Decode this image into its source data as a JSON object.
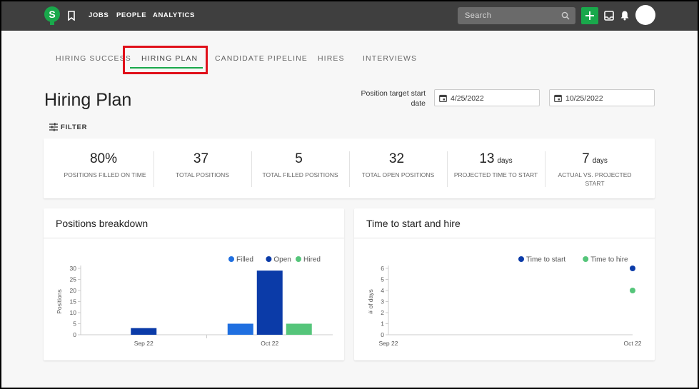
{
  "nav": {
    "logo_letter": "S",
    "links": [
      "JOBS",
      "PEOPLE",
      "ANALYTICS"
    ],
    "search_placeholder": "Search"
  },
  "tabs": [
    "HIRING SUCCESS",
    "HIRING PLAN",
    "CANDIDATE PIPELINE",
    "HIRES",
    "INTERVIEWS"
  ],
  "active_tab": "HIRING PLAN",
  "page": {
    "title": "Hiring Plan",
    "date_label": "Position target start date",
    "start_date": "4/25/2022",
    "end_date": "10/25/2022",
    "filter_label": "FILTER"
  },
  "stats": [
    {
      "value": "80%",
      "unit": "",
      "label": "POSITIONS FILLED ON TIME"
    },
    {
      "value": "37",
      "unit": "",
      "label": "TOTAL POSITIONS"
    },
    {
      "value": "5",
      "unit": "",
      "label": "TOTAL FILLED POSITIONS"
    },
    {
      "value": "32",
      "unit": "",
      "label": "TOTAL OPEN POSITIONS"
    },
    {
      "value": "13",
      "unit": "days",
      "label": "PROJECTED TIME TO START"
    },
    {
      "value": "7",
      "unit": "days",
      "label": "ACTUAL VS. PROJECTED START"
    }
  ],
  "colors": {
    "brand_green": "#19a84b",
    "filled": "#1f6fe0",
    "open": "#0b3ba8",
    "hired": "#55c57a",
    "time_to_start": "#0b3ba8",
    "time_to_hire": "#55c57a",
    "highlight": "#e0101a"
  },
  "charts": {
    "positions_title": "Positions breakdown",
    "time_title": "Time to start and hire"
  },
  "chart_data": [
    {
      "type": "bar",
      "title": "Positions breakdown",
      "ylabel": "Positions",
      "xlabel": "",
      "categories": [
        "Sep 22",
        "Oct 22"
      ],
      "ylim": [
        0,
        30
      ],
      "yticks": [
        0,
        5,
        10,
        15,
        20,
        25,
        30
      ],
      "legend_position": "top-right",
      "series": [
        {
          "name": "Filled",
          "values": [
            0,
            5
          ]
        },
        {
          "name": "Open",
          "values": [
            3,
            29
          ]
        },
        {
          "name": "Hired",
          "values": [
            0,
            5
          ]
        }
      ]
    },
    {
      "type": "scatter",
      "title": "Time to start and hire",
      "ylabel": "# of days",
      "xlabel": "",
      "categories": [
        "Sep 22",
        "Oct 22"
      ],
      "ylim": [
        0,
        6
      ],
      "yticks": [
        0,
        1,
        2,
        3,
        4,
        5,
        6
      ],
      "legend_position": "top-right",
      "series": [
        {
          "name": "Time to start",
          "points": [
            {
              "x": "Oct 22",
              "y": 6
            }
          ]
        },
        {
          "name": "Time to hire",
          "points": [
            {
              "x": "Oct 22",
              "y": 4
            }
          ]
        }
      ]
    }
  ]
}
